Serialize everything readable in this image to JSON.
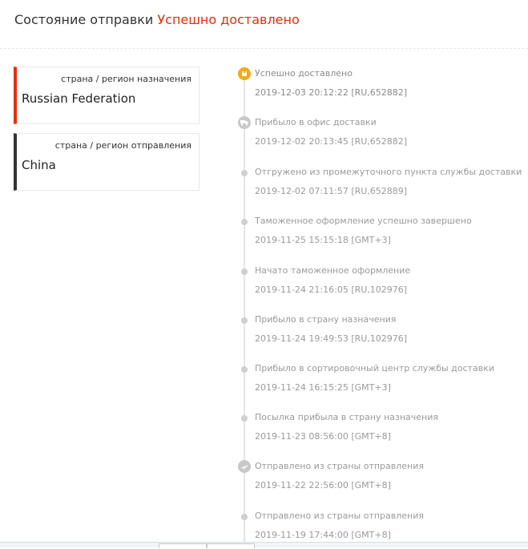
{
  "header": {
    "title": "Состояние отправки",
    "status": "Успешно доставлено"
  },
  "destination": {
    "label": "страна / регион назначения",
    "value": "Russian Federation"
  },
  "origin": {
    "label": "страна / регион отправления",
    "value": "China"
  },
  "colors": {
    "accent": "#e62e04",
    "delivered_icon": "#f5a623",
    "origin_bar": "#333333"
  },
  "events": [
    {
      "title": "Успешно доставлено",
      "time": "2019-12-03 20:12:22 [RU,652882]",
      "icon": "package-delivered-icon"
    },
    {
      "title": "Прибыло в офис доставки",
      "time": "2019-12-02 20:13:45 [RU,652882]",
      "icon": "truck-icon"
    },
    {
      "title": "Отгружено из промежуточного пункта службы доставки",
      "time": "2019-12-02 07:11:57 [RU,652889]",
      "icon": "dot-icon"
    },
    {
      "title": "Таможенное оформление успешно завершено",
      "time": "2019-11-25 15:15:18 [GMT+3]",
      "icon": "dot-icon"
    },
    {
      "title": "Начато таможенное оформление",
      "time": "2019-11-24 21:16:05 [RU,102976]",
      "icon": "dot-icon"
    },
    {
      "title": "Прибыло в страну назначения",
      "time": "2019-11-24 19:49:53 [RU,102976]",
      "icon": "dot-icon"
    },
    {
      "title": "Прибыло в сортировочный центр службы доставки",
      "time": "2019-11-24 16:15:25 [GMT+3]",
      "icon": "dot-icon"
    },
    {
      "title": "Посылка прибыла в страну назначения",
      "time": "2019-11-23 08:56:00 [GMT+8]",
      "icon": "dot-icon"
    },
    {
      "title": "Отправлено из страны отправления",
      "time": "2019-11-22 22:56:00 [GMT+8]",
      "icon": "plane-icon"
    },
    {
      "title": "Отправлено из страны отправления",
      "time": "2019-11-19 17:44:00 [GMT+8]",
      "icon": "dot-icon"
    }
  ]
}
